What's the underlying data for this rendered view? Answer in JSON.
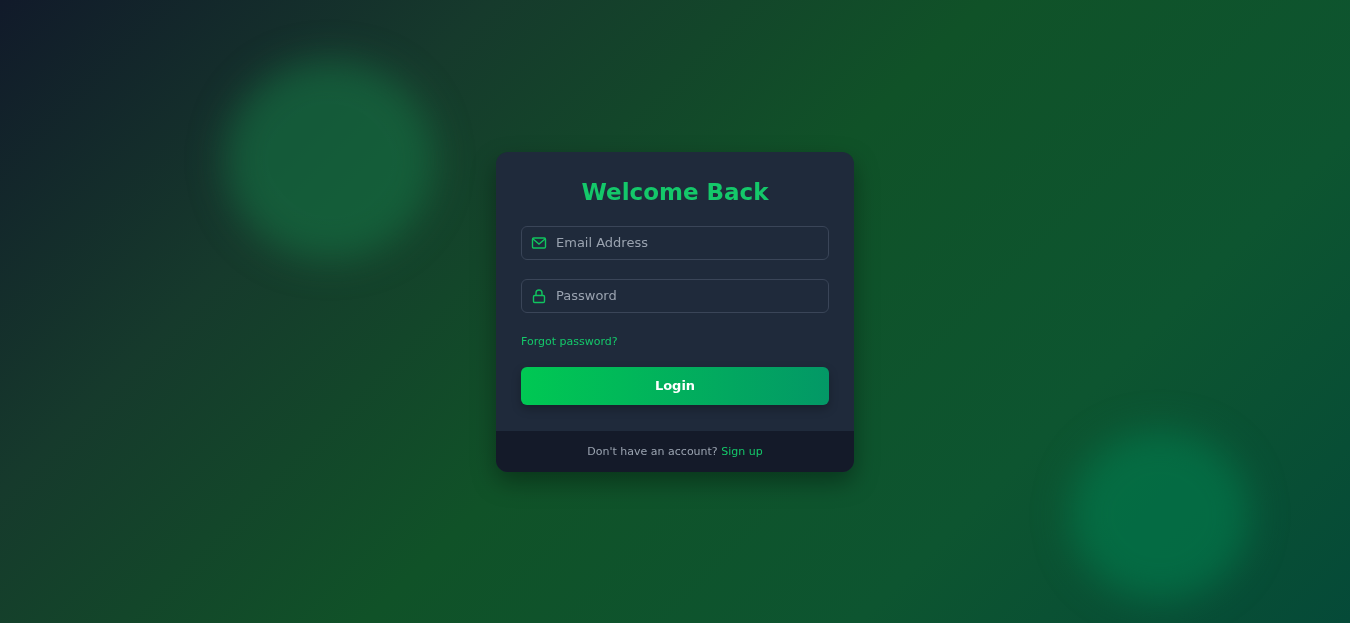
{
  "login_card": {
    "title": "Welcome Back",
    "fields": [
      {
        "kind": "email",
        "placeholder": "Email Address"
      },
      {
        "kind": "password",
        "placeholder": "Password"
      }
    ],
    "forgot_link": "Forgot password?",
    "submit_button": "Login",
    "footer": {
      "prompt": "Don't have an account?",
      "link": "Sign up"
    }
  }
}
